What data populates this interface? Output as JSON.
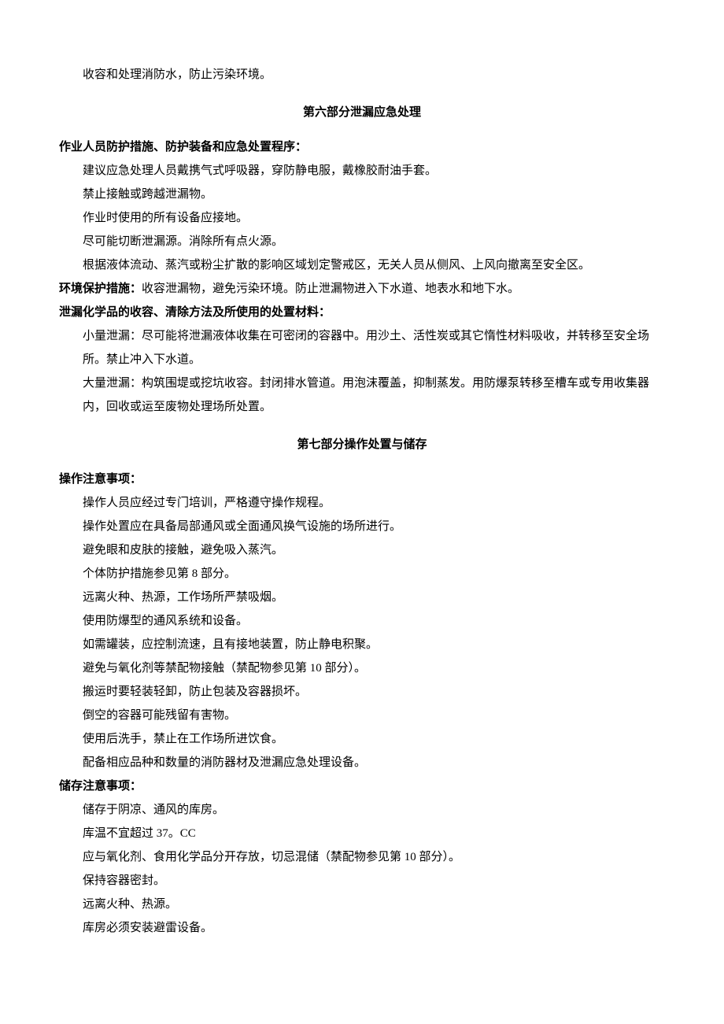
{
  "intro_line": "收容和处理消防水，防止污染环境。",
  "section6": {
    "title": "第六部分泄漏应急处理",
    "block1": {
      "heading": "作业人员防护措施、防护装备和应急处置程序：",
      "lines": [
        "建议应急处理人员戴携气式呼吸器，穿防静电服，戴橡胶耐油手套。",
        "禁止接触或跨越泄漏物。",
        "作业时使用的所有设备应接地。",
        "尽可能切断泄漏源。消除所有点火源。",
        "根据液体流动、蒸汽或粉尘扩散的影响区域划定警戒区，无关人员从侧风、上风向撤离至安全区。"
      ]
    },
    "env_label": "环境保护措施：",
    "env_text": "收容泄漏物，避免污染环境。防止泄漏物进入下水道、地表水和地下水。",
    "block3": {
      "heading": "泄漏化学品的收容、清除方法及所使用的处置材料：",
      "lines": [
        "小量泄漏：尽可能将泄漏液体收集在可密闭的容器中。用沙土、活性炭或其它惰性材料吸收，并转移至安全场所。禁止冲入下水道。",
        "大量泄漏：构筑围堤或挖坑收容。封闭排水管道。用泡沫覆盖，抑制蒸发。用防爆泵转移至槽车或专用收集器内，回收或运至废物处理场所处置。"
      ]
    }
  },
  "section7": {
    "title": "第七部分操作处置与储存",
    "op_heading": "操作注意事项：",
    "op_lines": [
      "操作人员应经过专门培训，严格遵守操作规程。",
      "操作处置应在具备局部通风或全面通风换气设施的场所进行。",
      "避免眼和皮肤的接触，避免吸入蒸汽。",
      "个体防护措施参见第 8 部分。",
      "远离火种、热源，工作场所严禁吸烟。",
      "使用防爆型的通风系统和设备。",
      "如需罐装，应控制流速，且有接地装置，防止静电积聚。",
      "避免与氧化剂等禁配物接触（禁配物参见第 10 部分）。",
      "搬运时要轻装轻卸，防止包装及容器损坏。",
      "倒空的容器可能残留有害物。",
      "使用后洗手，禁止在工作场所进饮食。",
      "配备相应品种和数量的消防器材及泄漏应急处理设备。"
    ],
    "store_heading": "储存注意事项：",
    "store_lines": [
      "储存于阴凉、通风的库房。",
      "库温不宜超过 37。CC",
      "应与氧化剂、食用化学品分开存放，切忌混储（禁配物参见第 10 部分）。",
      "保持容器密封。",
      "远离火种、热源。",
      "库房必须安装避雷设备。"
    ]
  }
}
